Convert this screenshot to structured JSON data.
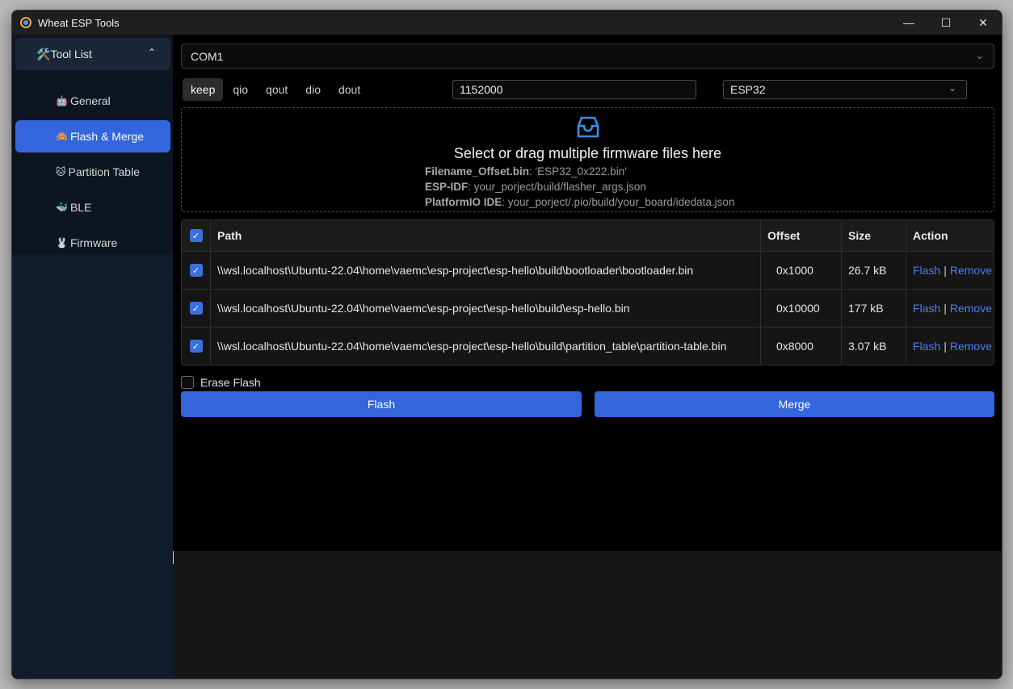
{
  "window": {
    "title": "Wheat ESP Tools",
    "controls": {
      "minimize": "—",
      "maximize": "☐",
      "close": "✕"
    }
  },
  "sidebar": {
    "header": {
      "icon": "🛠️",
      "label": "Tool List",
      "chevron": "⌃"
    },
    "items": [
      {
        "icon": "🤖",
        "label": "General",
        "active": false
      },
      {
        "icon": "🙈",
        "label": "Flash & Merge",
        "active": true
      },
      {
        "icon": "🐱",
        "label": "Partition Table",
        "active": false
      },
      {
        "icon": "🐳",
        "label": "BLE",
        "active": false
      },
      {
        "icon": "🐰",
        "label": "Firmware",
        "active": false
      }
    ]
  },
  "port": {
    "value": "COM1",
    "arrow": "⌄"
  },
  "flash_modes": {
    "options": [
      "keep",
      "qio",
      "qout",
      "dio",
      "dout"
    ],
    "selected": "keep"
  },
  "baud_rate": "1152000",
  "chip": {
    "value": "ESP32",
    "arrow": "⌄"
  },
  "dropzone": {
    "icon": "inbox-icon",
    "title": "Select or drag multiple firmware files here",
    "lines": [
      {
        "key": "Filename_Offset.bin",
        "value": ": 'ESP32_0x222.bin'"
      },
      {
        "key": "ESP-IDF",
        "value": ": your_porject/build/flasher_args.json"
      },
      {
        "key": "PlatformIO IDE",
        "value": ": your_porject/.pio/build/your_board/idedata.json"
      }
    ]
  },
  "table": {
    "headers": {
      "path": "Path",
      "offset": "Offset",
      "size": "Size",
      "action": "Action"
    },
    "rows": [
      {
        "checked": true,
        "path": "\\\\wsl.localhost\\Ubuntu-22.04\\home\\vaemc\\esp-project\\esp-hello\\build\\bootloader\\bootloader.bin",
        "offset": "0x1000",
        "size": "26.7 kB",
        "flash": "Flash",
        "sep": "|",
        "remove": "Remove"
      },
      {
        "checked": true,
        "path": "\\\\wsl.localhost\\Ubuntu-22.04\\home\\vaemc\\esp-project\\esp-hello\\build\\esp-hello.bin",
        "offset": "0x10000",
        "size": "177 kB",
        "flash": "Flash",
        "sep": "|",
        "remove": "Remove"
      },
      {
        "checked": true,
        "path": "\\\\wsl.localhost\\Ubuntu-22.04\\home\\vaemc\\esp-project\\esp-hello\\build\\partition_table\\partition-table.bin",
        "offset": "0x8000",
        "size": "3.07 kB",
        "flash": "Flash",
        "sep": "|",
        "remove": "Remove"
      }
    ]
  },
  "erase_flash": {
    "label": "Erase Flash",
    "checked": false
  },
  "buttons": {
    "flash": "Flash",
    "merge": "Merge"
  },
  "colors": {
    "accent": "#3565db",
    "link": "#4a7df0"
  }
}
